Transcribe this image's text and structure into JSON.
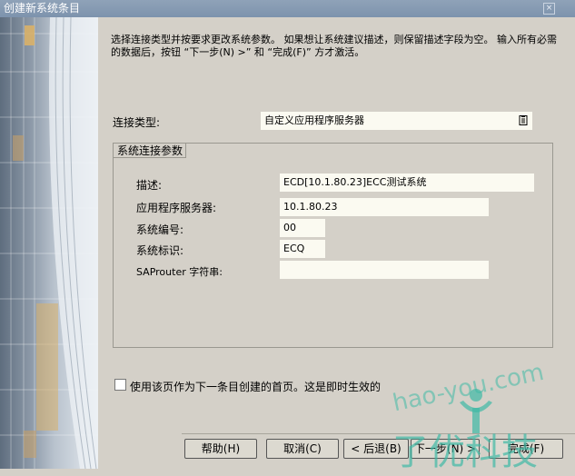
{
  "window": {
    "title": "创建新系统条目",
    "close_glyph": "×"
  },
  "intro_text": "选择连接类型并按要求更改系统参数。 如果想让系统建议描述，则保留描述字段为空。 输入所有必需的数据后，按钮 “下一步(N) >” 和 “完成(F)” 方才激活。",
  "connection": {
    "label": "连接类型:",
    "value": "自定义应用程序服务器"
  },
  "params": {
    "title": "系统连接参数",
    "description": {
      "label": "描述:",
      "value": "ECD[10.1.80.23]ECC测试系统"
    },
    "app_server": {
      "label": "应用程序服务器:",
      "value": "10.1.80.23"
    },
    "system_number": {
      "label": "系统编号:",
      "value": "00"
    },
    "system_id": {
      "label": "系统标识:",
      "value": "ECQ"
    },
    "saprouter": {
      "label": "SAProuter 字符串:",
      "value": ""
    }
  },
  "startpage_checkbox": {
    "label": "使用该页作为下一条目创建的首页。这是即时生效的",
    "checked": false
  },
  "buttons": {
    "help": "帮助(H)",
    "cancel": "取消(C)",
    "back": "< 后退(B)",
    "next": "下一步(N) >",
    "finish": "完成(F)"
  },
  "watermark": {
    "text": "hao-you.com",
    "brand": "了优科技"
  },
  "colors": {
    "titlebar": "#8fa2b8",
    "field_bg": "#fbfaf1",
    "dialog_bg": "#d4d0c8",
    "watermark": "#3fb9a5"
  }
}
